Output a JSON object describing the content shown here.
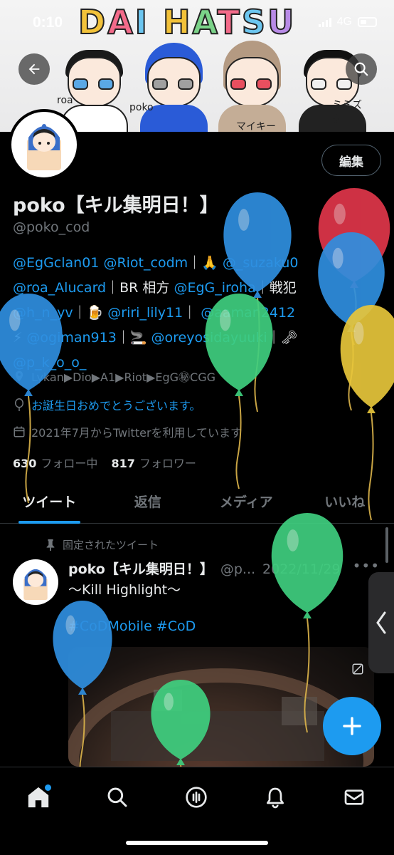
{
  "status_bar": {
    "time": "0:10",
    "network": "4G"
  },
  "banner": {
    "title_letters": [
      "D",
      "A",
      "I",
      " ",
      "H",
      "A",
      "T",
      "S",
      "U"
    ],
    "title_colors": [
      "#f2c23a",
      "#f36b8a",
      "#6cc6f0",
      "",
      "#f2c23a",
      "#7bd389",
      "#f36b8a",
      "#6cc6f0",
      "#b88be6"
    ],
    "characters": [
      {
        "label": "roa",
        "hair": "#1a1a1a",
        "eye": "#5aa8e6",
        "body": "#ffffff"
      },
      {
        "label": "poko",
        "hair": "#2a5bd7",
        "eye": "#a0a0a0",
        "body": "#2a5bd7"
      },
      {
        "label": "マイキー",
        "hair": "#b49a82",
        "eye": "#e84f5f",
        "body": "#c4ad96"
      },
      {
        "label": "ミミズク",
        "hair": "#111111",
        "eye": "#f0f0f0",
        "body": "#222222"
      }
    ]
  },
  "nav": {
    "back_icon": "arrow-left-icon",
    "search_icon": "search-icon"
  },
  "profile": {
    "edit_label": "編集",
    "name": "poko【キル集明日！】",
    "handle": "@poko_cod",
    "bio_lines": [
      [
        {
          "t": "@EgGclan01",
          "m": true
        },
        {
          "t": " "
        },
        {
          "t": "@Riot_codm",
          "m": true
        },
        {
          "t": "｜🙏 "
        },
        {
          "t": "@_suzaku0",
          "m": true
        }
      ],
      [
        {
          "t": "@roa_Alucard",
          "m": true
        },
        {
          "t": "｜BR 相方 "
        },
        {
          "t": "@EgG_iroha",
          "m": true
        },
        {
          "t": "｜戦犯"
        }
      ],
      [
        {
          "t": "@h_n_yv",
          "m": true
        },
        {
          "t": "｜🍺 "
        },
        {
          "t": "@riri_lily11",
          "m": true
        },
        {
          "t": "｜ "
        },
        {
          "t": "@aaman2412",
          "m": true
        }
      ],
      [
        {
          "t": "⚡ "
        },
        {
          "t": "@ogiman913",
          "m": true
        },
        {
          "t": "｜🚬 "
        },
        {
          "t": "@oreyosidayuuki",
          "m": true
        },
        {
          "t": "｜🗝"
        }
      ],
      [
        {
          "t": "@p_k_o_o_",
          "m": true
        }
      ]
    ],
    "location": "Lykan▶Dio▶A1▶Riot▶EgG㊙CGG",
    "birthday": "お誕生日おめでとうございます。",
    "joined": "2021年7月からTwitterを利用しています",
    "following_count": "630",
    "following_label": "フォロー中",
    "followers_count": "817",
    "followers_label": "フォロワー"
  },
  "tabs": [
    {
      "label": "ツイート",
      "active": true
    },
    {
      "label": "返信",
      "active": false
    },
    {
      "label": "メディア",
      "active": false
    },
    {
      "label": "いいね",
      "active": false
    }
  ],
  "pinned_tweet": {
    "pinned_label": "固定されたツイート",
    "author": "poko【キル集明日！】",
    "handle": "@p...",
    "date": "2022/11/29",
    "text": "〜Kill Highlight〜",
    "hashtags": "#CoDMobile #CoD"
  },
  "balloon_colors": {
    "blue": "#2f8fe0",
    "green": "#3fcf7f",
    "red": "#e0364a",
    "yellow": "#e7c63b"
  },
  "accent": "#1d9bf0"
}
